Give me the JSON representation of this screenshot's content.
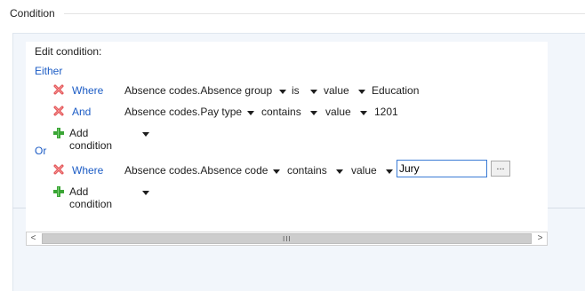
{
  "group": {
    "title": "Condition"
  },
  "editor": {
    "label": "Edit condition:",
    "either_label": "Either",
    "or_label": "Or",
    "either_conditions": [
      {
        "keyword": "Where",
        "field": "Absence codes.Absence group",
        "operator": "is",
        "value_type": "value",
        "value": "Education"
      },
      {
        "keyword": "And",
        "field": "Absence codes.Pay type",
        "operator": "contains",
        "value_type": "value",
        "value": "1201"
      }
    ],
    "or_conditions": [
      {
        "keyword": "Where",
        "field": "Absence codes.Absence code",
        "operator": "contains",
        "value_type": "value",
        "value": "Jury"
      }
    ],
    "add_condition_label": "Add condition",
    "browse_button": "..."
  },
  "scrollbar": {
    "left_arrow": "<",
    "right_arrow": ">",
    "grip": "III"
  },
  "icons": {
    "delete": "delete-x-icon",
    "add": "green-plus-icon",
    "dropdown": "triangle-down-icon"
  },
  "colors": {
    "link_blue": "#1c5cc5",
    "delete_red": "#e0494b",
    "add_green": "#3aa535",
    "input_border": "#3a7bd5"
  }
}
